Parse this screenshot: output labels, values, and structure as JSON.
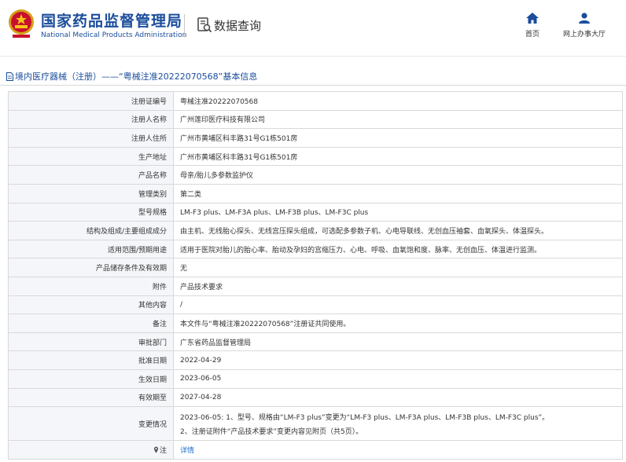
{
  "header": {
    "brand_cn": "国家药品监督管理局",
    "brand_en": "National Medical Products Administration",
    "query_label": "数据查询",
    "nav": {
      "home": "首页",
      "service_hall": "网上办事大厅"
    },
    "icons": {
      "emblem": "national-emblem-icon",
      "query": "document-search-icon",
      "home": "home-icon",
      "user": "user-icon"
    },
    "accent_color": "#1b4d9c"
  },
  "page_title": "境内医疗器械（注册）——“粤械注准20222070568”基本信息",
  "record": {
    "rows": [
      {
        "label": "注册证编号",
        "value": "粤械注准20222070568"
      },
      {
        "label": "注册人名称",
        "value": "广州莲印医疗科技有限公司"
      },
      {
        "label": "注册人住所",
        "value": "广州市黄埔区科丰路31号G1栋501房"
      },
      {
        "label": "生产地址",
        "value": "广州市黄埔区科丰路31号G1栋501房"
      },
      {
        "label": "产品名称",
        "value": "母亲/胎儿多参数监护仪"
      },
      {
        "label": "管理类别",
        "value": "第二类"
      },
      {
        "label": "型号规格",
        "value": "LM-F3 plus、LM-F3A plus、LM-F3B plus、LM-F3C plus"
      },
      {
        "label": "结构及组成/主要组成成分",
        "value": "由主机、无线胎心探头、无线宫压探头组成，可选配多参数子机、心电导联线、无创血压袖套、血氧探头、体温探头。"
      },
      {
        "label": "适用范围/预期用途",
        "value": "适用于医院对胎儿的胎心率、胎动及孕妇的宫缩压力、心电、呼吸、血氧饱和度、脉率、无创血压、体温进行监测。"
      },
      {
        "label": "产品储存条件及有效期",
        "value": "无"
      },
      {
        "label": "附件",
        "value": "产品技术要求"
      },
      {
        "label": "其他内容",
        "value": "/"
      },
      {
        "label": "备注",
        "value": "本文件与“粤械注准20222070568”注册证共同使用。"
      },
      {
        "label": "审批部门",
        "value": "广东省药品监督管理局"
      },
      {
        "label": "批准日期",
        "value": "2022-04-29"
      },
      {
        "label": "生效日期",
        "value": "2023-06-05"
      },
      {
        "label": "有效期至",
        "value": "2027-04-28"
      }
    ],
    "change": {
      "label": "变更情况",
      "line1": "2023-06-05: 1、型号、规格由“LM-F3 plus”变更为“LM-F3 plus、LM-F3A plus、LM-F3B plus、LM-F3C plus”。",
      "line2": "2、注册证附件“产品技术要求”变更内容见附页（共5页）。"
    },
    "note": {
      "label": "注",
      "value": "详情",
      "icon": "pin-icon"
    }
  }
}
